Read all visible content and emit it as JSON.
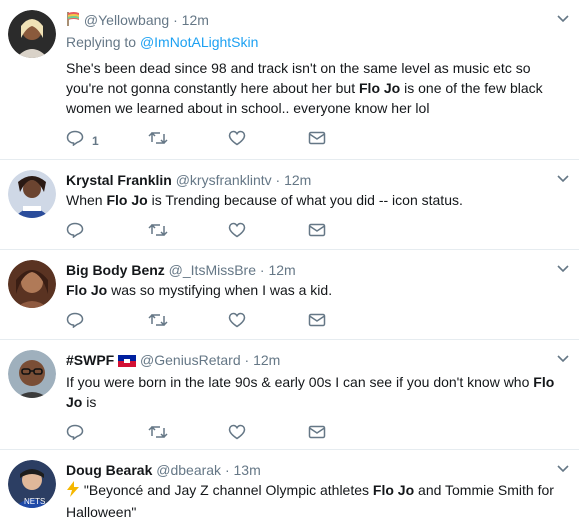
{
  "tweets": [
    {
      "name": "",
      "handle": "@Yellowbang",
      "dot": "·",
      "time": "12m",
      "replying_prefix": "Replying to ",
      "replying_handle": "@ImNotALightSkin",
      "text_before": "She's been dead since 98 and track isn't on the same level as music etc so you're not gonna constantly here about her but ",
      "text_bold": "Flo Jo",
      "text_after": " is one of the few black women we learned about in school.. everyone know her lol",
      "reply_count": "1"
    },
    {
      "name": "Krystal Franklin",
      "handle": "@krysfranklintv",
      "dot": "·",
      "time": "12m",
      "text_before": "When ",
      "text_bold": "Flo Jo",
      "text_after": " is Trending because of what you did -- icon status."
    },
    {
      "name": "Big Body Benz",
      "handle": "@_ItsMissBre",
      "dot": "·",
      "time": "12m",
      "text_before": "",
      "text_bold": "Flo Jo",
      "text_after": " was so mystifying when I was a kid."
    },
    {
      "name": "#SWPF",
      "handle": "@GeniusRetard",
      "dot": "·",
      "time": "12m",
      "text_before": "If you were born in the late 90s & early 00s I can see if you don't know who ",
      "text_bold": "Flo Jo",
      "text_after": " is"
    },
    {
      "name": "Doug Bearak",
      "handle": "@dbearak",
      "dot": "·",
      "time": "13m",
      "text_before": "\"Beyoncé and Jay Z channel Olympic athletes ",
      "text_bold": "Flo Jo",
      "text_after": " and Tommie Smith for Halloween\""
    }
  ],
  "icons": {
    "reply": "reply-icon",
    "retweet": "retweet-icon",
    "like": "heart-icon",
    "dm": "envelope-icon",
    "caret": "chevron-down-icon"
  },
  "colors": {
    "link": "#1da1f2",
    "muted": "#657786",
    "text": "#14171a",
    "divider": "#e6ecf0"
  }
}
